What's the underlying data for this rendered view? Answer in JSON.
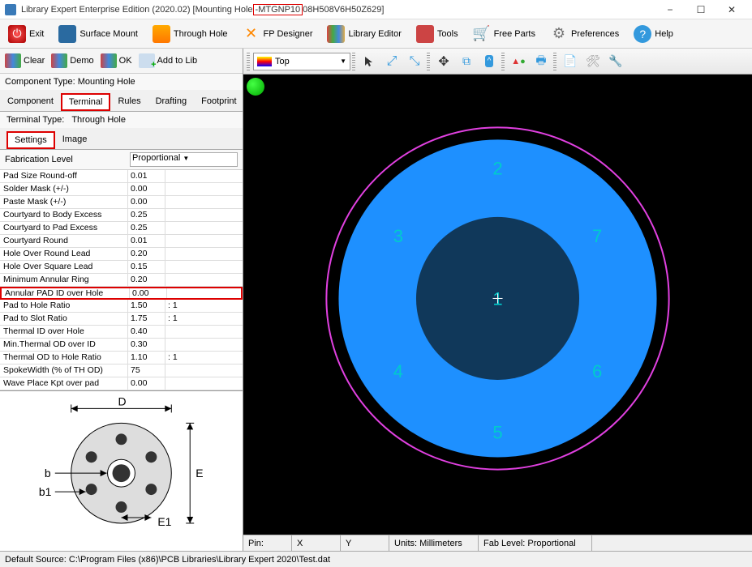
{
  "title": {
    "prefix": "Library Expert Enterprise Edition (2020.02) [Mounting Hole",
    "highlight": "-MTGNP10",
    "suffix": "08H508V6H50Z629]"
  },
  "window_controls": {
    "min": "−",
    "max": "☐",
    "close": "✕"
  },
  "main_toolbar": [
    {
      "label": "Exit",
      "icon": "exit"
    },
    {
      "label": "Surface Mount",
      "icon": "smt"
    },
    {
      "label": "Through Hole",
      "icon": "th"
    },
    {
      "label": "FP Designer",
      "icon": "fpd"
    },
    {
      "label": "Library Editor",
      "icon": "libed"
    },
    {
      "label": "Tools",
      "icon": "tools"
    },
    {
      "label": "Free Parts",
      "icon": "cart"
    },
    {
      "label": "Preferences",
      "icon": "prefs"
    },
    {
      "label": "Help",
      "icon": "help"
    }
  ],
  "left_toolbar": [
    {
      "label": "Clear"
    },
    {
      "label": "Demo"
    },
    {
      "label": "OK"
    },
    {
      "label": "Add to Lib"
    }
  ],
  "component_type": {
    "label": "Component Type:",
    "value": "Mounting Hole"
  },
  "tabs": [
    "Component",
    "Terminal",
    "Rules",
    "Drafting",
    "Footprint"
  ],
  "active_tab": "Terminal",
  "terminal_type": {
    "label": "Terminal Type:",
    "value": "Through Hole"
  },
  "subtabs": [
    "Settings",
    "Image"
  ],
  "active_subtab": "Settings",
  "fabrication": {
    "label": "Fabrication Level",
    "value": "Proportional"
  },
  "settings": [
    {
      "label": "Pad Size Round-off",
      "value": "0.01"
    },
    {
      "label": "Solder Mask (+/-)",
      "value": "0.00"
    },
    {
      "label": "Paste Mask (+/-)",
      "value": "0.00"
    },
    {
      "label": "Courtyard to Body Excess",
      "value": "0.25"
    },
    {
      "label": "Courtyard to Pad Excess",
      "value": "0.25"
    },
    {
      "label": "Courtyard Round",
      "value": "0.01"
    },
    {
      "label": "Hole Over Round Lead",
      "value": "0.20"
    },
    {
      "label": "Hole Over Square Lead",
      "value": "0.15"
    },
    {
      "label": "Minimum Annular Ring",
      "value": "0.20"
    },
    {
      "label": "Annular PAD ID over Hole",
      "value": "0.00",
      "hl": true
    },
    {
      "label": "Pad to Hole Ratio",
      "value": "1.50",
      "suffix": ": 1"
    },
    {
      "label": "Pad to Slot Ratio",
      "value": "1.75",
      "suffix": ": 1"
    },
    {
      "label": "Thermal ID over Hole",
      "value": "0.40"
    },
    {
      "label": "Min.Thermal OD over ID",
      "value": "0.30"
    },
    {
      "label": "Thermal OD to Hole Ratio",
      "value": "1.10",
      "suffix": ": 1"
    },
    {
      "label": "SpokeWidth (% of TH OD)",
      "value": "75"
    },
    {
      "label": "Wave Place Kpt over pad",
      "value": "0.00"
    }
  ],
  "diagram_labels": {
    "D": "D",
    "E": "E",
    "E1": "E1",
    "b": "b",
    "b1": "b1"
  },
  "layer_selector": "Top",
  "pad_numbers": [
    "1",
    "2",
    "3",
    "4",
    "5",
    "6",
    "7"
  ],
  "right_status": {
    "pin": "Pin:",
    "x": "X",
    "y": "Y",
    "units": "Units: Millimeters",
    "fab": "Fab Level: Proportional"
  },
  "bottom_status_label": "Default Source:",
  "bottom_status_path": "C:\\Program Files (x86)\\PCB Libraries\\Library Expert 2020\\Test.dat"
}
